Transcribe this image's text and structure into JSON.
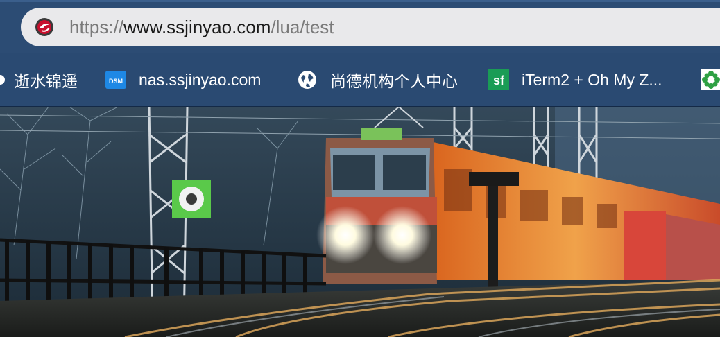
{
  "address_bar": {
    "scheme": "https://",
    "host": "www.ssjinyao.com",
    "path": "/lua/test"
  },
  "bookmarks": [
    {
      "label": "逝水锦遥",
      "icon": "partial-icon"
    },
    {
      "label": "nas.ssjinyao.com",
      "icon": "dsm-icon",
      "icon_text": "DSM"
    },
    {
      "label": "尚德机构个人中心",
      "icon": "globe-icon"
    },
    {
      "label": "iTerm2 + Oh My Z...",
      "icon": "sf-icon",
      "icon_text": "sf"
    },
    {
      "label": "",
      "icon": "green-flower-icon"
    }
  ],
  "colors": {
    "toolbar": "#2c4c74",
    "bookmark_bar": "#2a4a72",
    "url_field": "#e9e9eb",
    "dsm_blue": "#1e88e5",
    "sf_green": "#1a9c55"
  },
  "hero": {
    "description_icon": "train-night-photo"
  }
}
